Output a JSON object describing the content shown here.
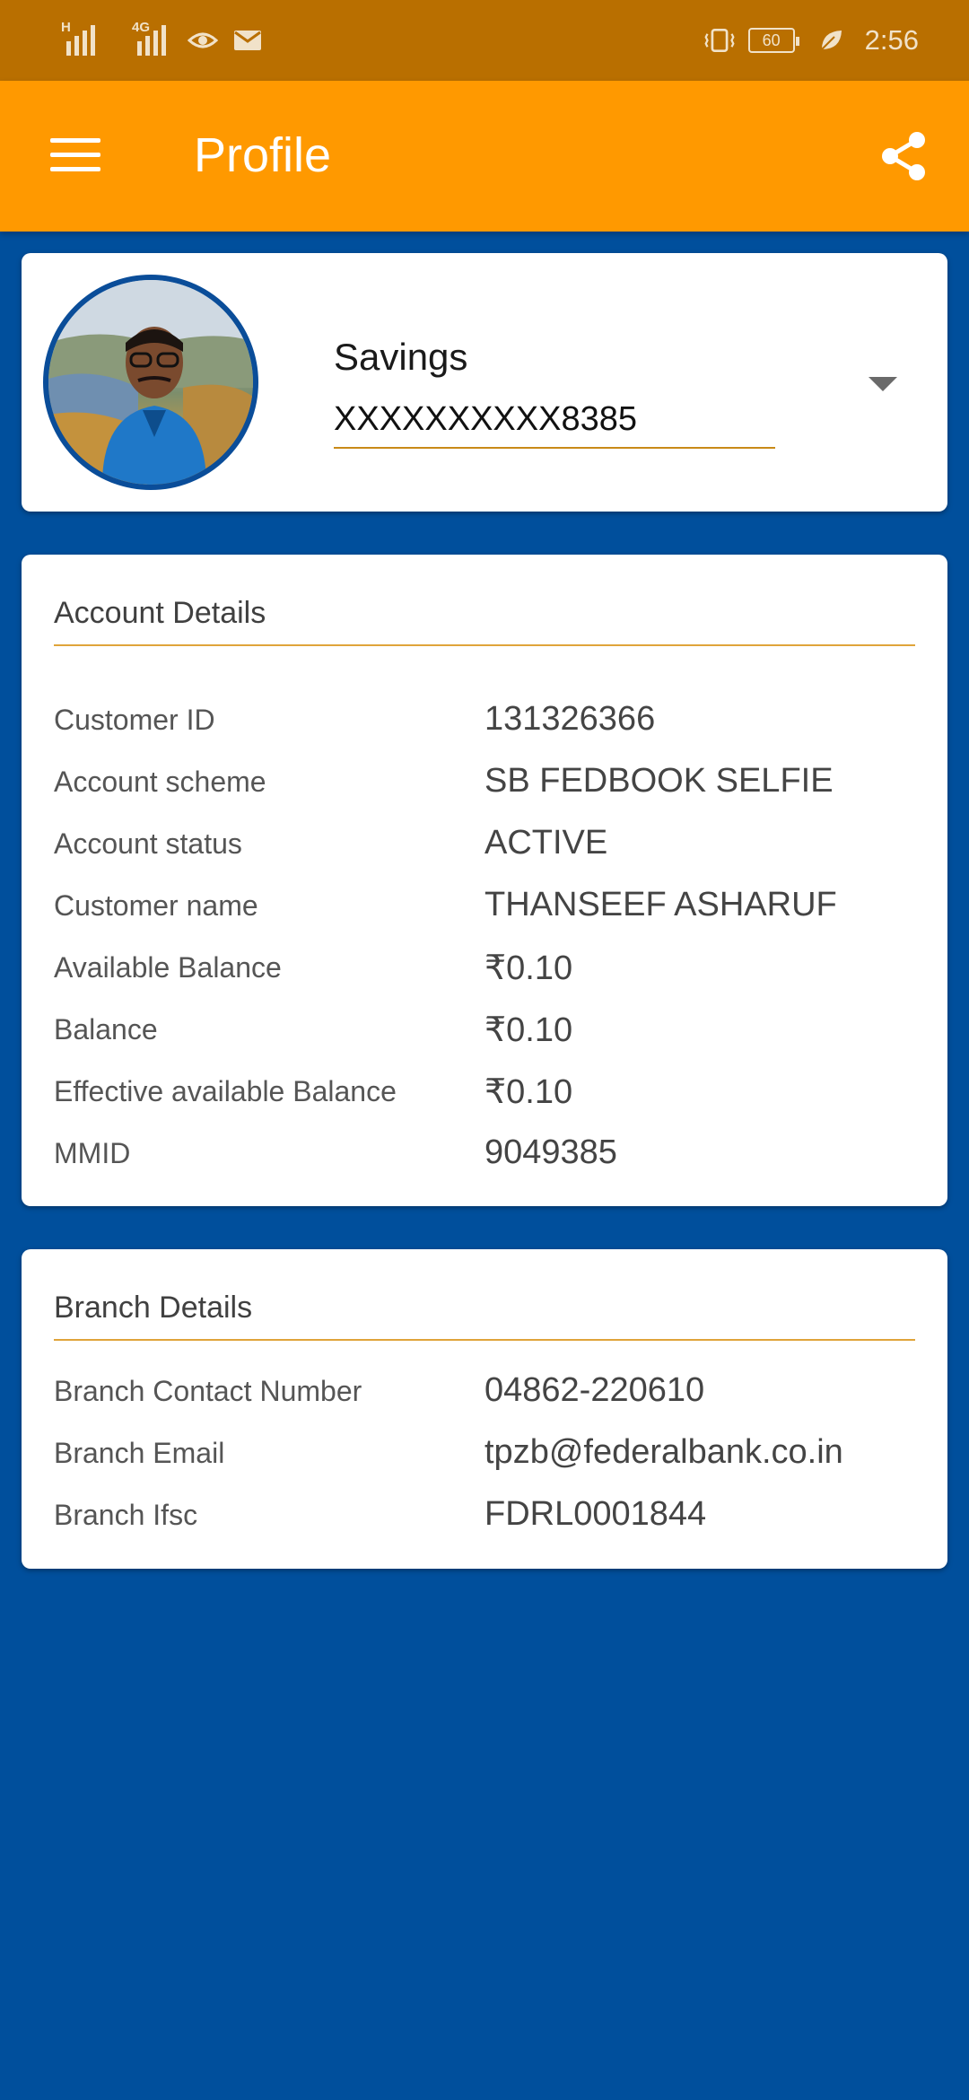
{
  "status_bar": {
    "signal1_tag": "H",
    "signal2_tag": "4G",
    "battery": "60",
    "time": "2:56"
  },
  "app_bar": {
    "title": "Profile"
  },
  "account_selector": {
    "type": "Savings",
    "number": "XXXXXXXXXX8385"
  },
  "account_details": {
    "title": "Account Details",
    "rows": [
      {
        "label": "Customer ID",
        "value": "131326366"
      },
      {
        "label": "Account scheme",
        "value": "SB FEDBOOK SELFIE"
      },
      {
        "label": "Account status",
        "value": "ACTIVE"
      },
      {
        "label": "Customer name",
        "value": "THANSEEF ASHARUF"
      },
      {
        "label": "Available Balance",
        "value": "₹0.10"
      },
      {
        "label": "Balance",
        "value": "₹0.10"
      },
      {
        "label": "Effective available Balance",
        "value": "₹0.10"
      },
      {
        "label": "MMID",
        "value": "9049385"
      }
    ]
  },
  "branch_details": {
    "title": "Branch Details",
    "rows": [
      {
        "label": "Branch Contact Number",
        "value": "04862-220610"
      },
      {
        "label": "Branch Email",
        "value": "tpzb@federalbank.co.in"
      },
      {
        "label": "Branch Ifsc",
        "value": "FDRL0001844"
      }
    ]
  },
  "colors": {
    "status_bar": "#b96f00",
    "app_bar": "#ff9900",
    "background": "#004f9c",
    "accent_rule": "#e0a43a"
  },
  "icons": [
    "menu-icon",
    "share-icon",
    "dropdown-arrow-icon",
    "vibrate-icon",
    "eye-icon",
    "mail-icon",
    "leaf-icon"
  ]
}
